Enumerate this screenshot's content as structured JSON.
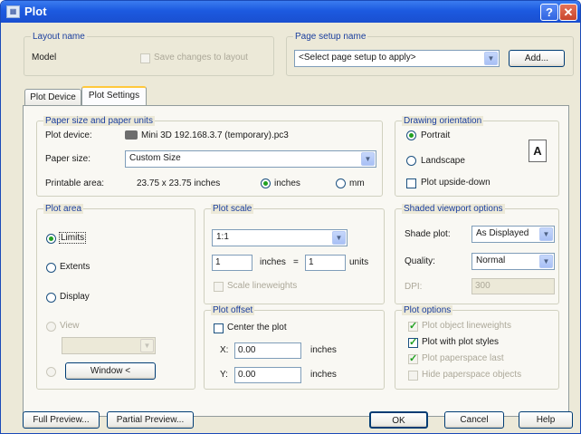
{
  "window": {
    "title": "Plot",
    "help_label": "?",
    "close_label": "✕"
  },
  "layout_name": {
    "legend": "Layout name",
    "value": "Model",
    "save_changes_label": "Save changes to layout"
  },
  "page_setup": {
    "legend": "Page setup name",
    "selected": "<Select page setup to apply>",
    "add_button": "Add..."
  },
  "tabs": [
    {
      "label": "Plot Device"
    },
    {
      "label": "Plot Settings"
    }
  ],
  "paper": {
    "legend": "Paper size and paper units",
    "plot_device_label": "Plot device:",
    "plot_device_value": "Mini 3D 192.168.3.7 (temporary).pc3",
    "paper_size_label": "Paper size:",
    "paper_size_value": "Custom Size",
    "printable_area_label": "Printable area:",
    "printable_area_value": "23.75 x 23.75 inches",
    "unit_inches": "inches",
    "unit_mm": "mm"
  },
  "orientation": {
    "legend": "Drawing orientation",
    "portrait": "Portrait",
    "landscape": "Landscape",
    "upside_down": "Plot upside-down",
    "paper_icon_letter": "A"
  },
  "plot_area": {
    "legend": "Plot area",
    "limits": "Limits",
    "extents": "Extents",
    "display": "Display",
    "view": "View",
    "window_button": "Window <"
  },
  "plot_scale": {
    "legend": "Plot scale",
    "scale_value": "1:1",
    "inches_value": "1",
    "inches_unit": "inches",
    "equals": "=",
    "units_value": "1",
    "units_label": "units",
    "scale_lineweights": "Scale lineweights"
  },
  "plot_offset": {
    "legend": "Plot offset",
    "center_plot": "Center the plot",
    "x_label": "X:",
    "x_value": "0.00",
    "x_unit": "inches",
    "y_label": "Y:",
    "y_value": "0.00",
    "y_unit": "inches"
  },
  "shaded": {
    "legend": "Shaded viewport options",
    "shade_plot_label": "Shade plot:",
    "shade_plot_value": "As Displayed",
    "quality_label": "Quality:",
    "quality_value": "Normal",
    "dpi_label": "DPI:",
    "dpi_value": "300"
  },
  "plot_options": {
    "legend": "Plot options",
    "lineweights": "Plot object lineweights",
    "plot_styles": "Plot with plot styles",
    "paperspace_last": "Plot paperspace last",
    "hide_objects": "Hide paperspace objects"
  },
  "footer": {
    "full_preview": "Full Preview...",
    "partial_preview": "Partial Preview...",
    "ok": "OK",
    "cancel": "Cancel",
    "help": "Help"
  },
  "colors": {
    "accent": "#1a3e9e",
    "titlebar": "#1c5ae0",
    "check": "#21a121"
  },
  "icons": {
    "printer": "printer-icon",
    "dropdown": "chevron-down-icon"
  }
}
